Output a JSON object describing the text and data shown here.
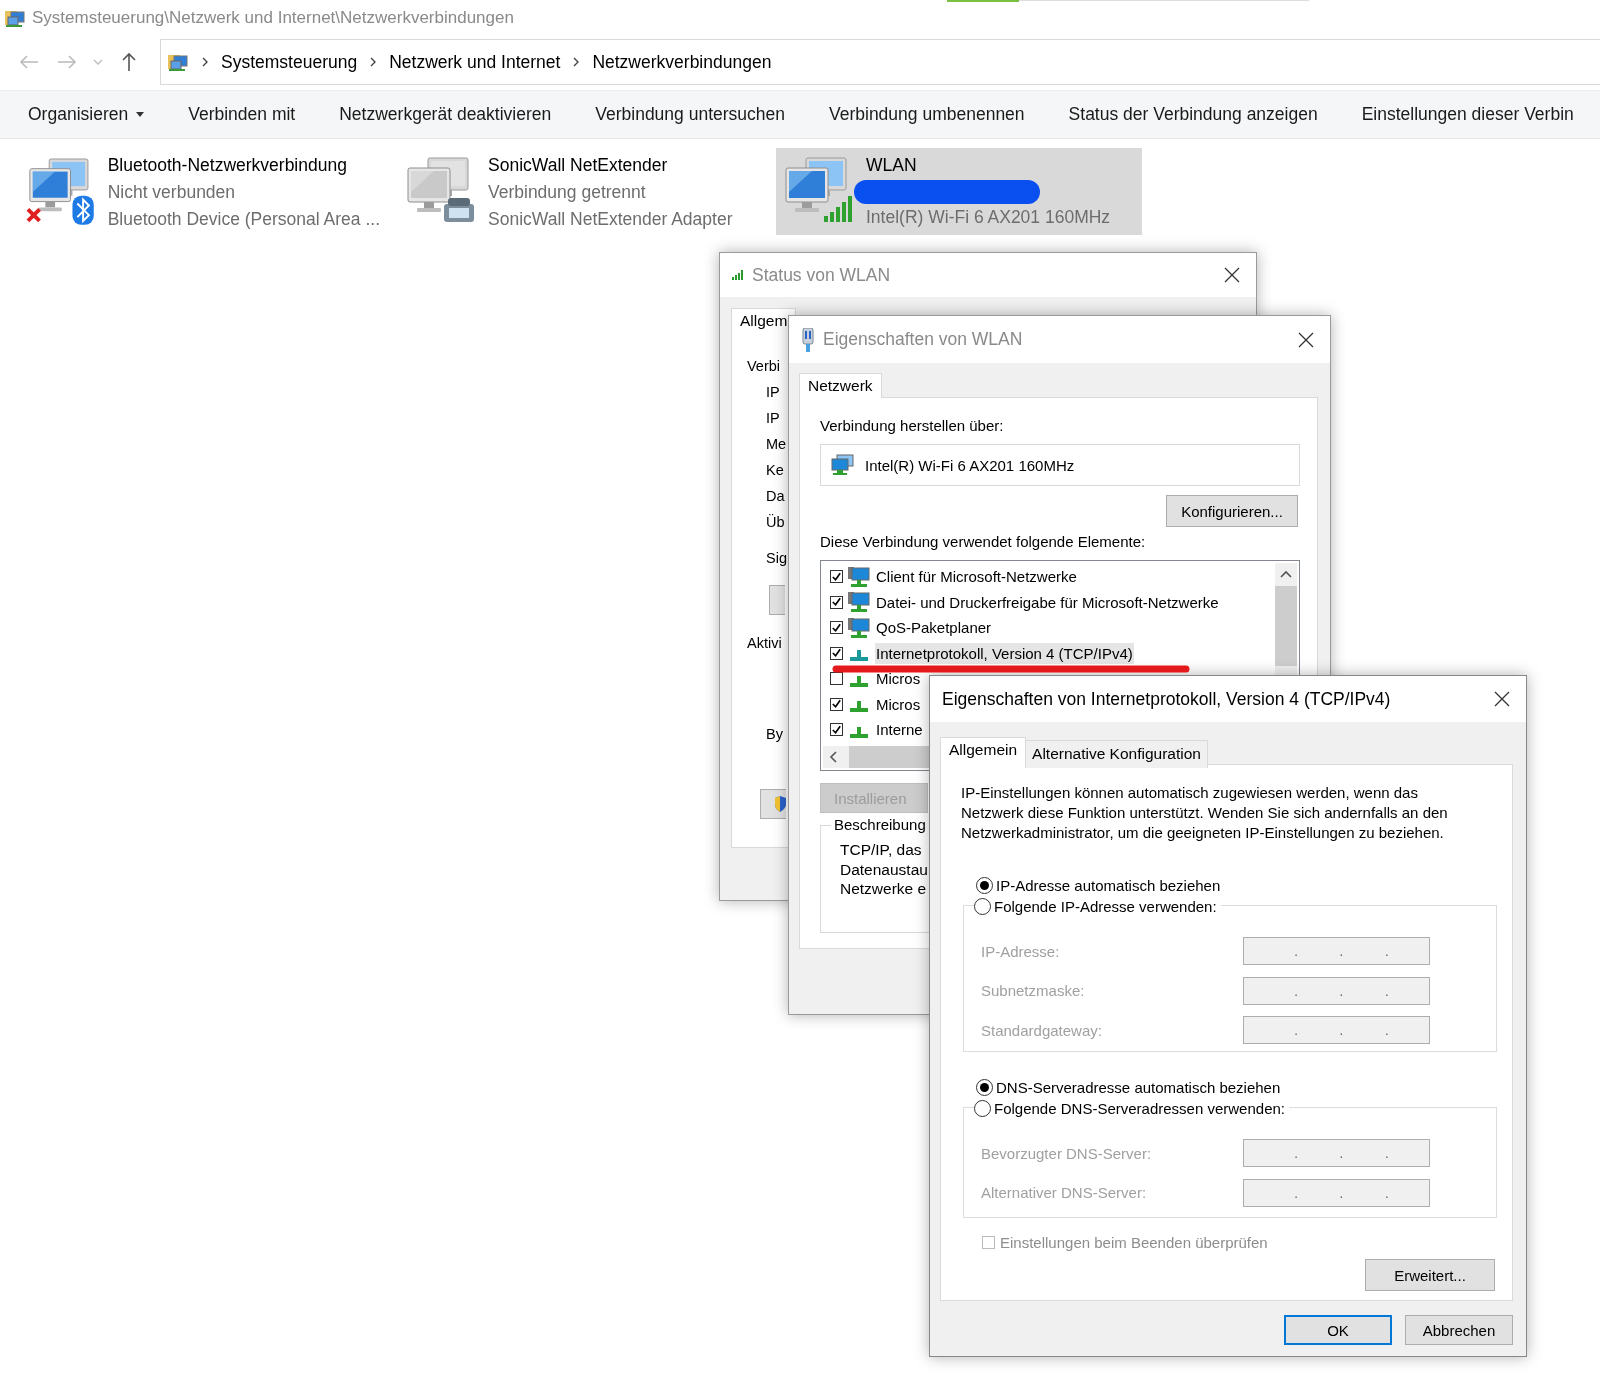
{
  "explorer": {
    "title": "Systemsteuerung\\Netzwerk und Internet\\Netzwerkverbindungen",
    "breadcrumbs": [
      "Systemsteuerung",
      "Netzwerk und Internet",
      "Netzwerkverbindungen"
    ],
    "toolbar": [
      {
        "label": "Organisieren",
        "dropdown": true
      },
      {
        "label": "Verbinden mit",
        "dropdown": false
      },
      {
        "label": "Netzwerkgerät deaktivieren",
        "dropdown": false
      },
      {
        "label": "Verbindung untersuchen",
        "dropdown": false
      },
      {
        "label": "Verbindung umbenennen",
        "dropdown": false
      },
      {
        "label": "Status der Verbindung anzeigen",
        "dropdown": false
      },
      {
        "label": "Einstellungen dieser Verbin",
        "dropdown": false
      }
    ],
    "connections": [
      {
        "kind": "bluetooth",
        "name": "Bluetooth-Netzwerkverbindung",
        "status": "Nicht verbunden",
        "device": "Bluetooth Device (Personal Area ...",
        "selected": false,
        "redacted": false
      },
      {
        "kind": "vpn",
        "name": "SonicWall NetExtender",
        "status": "Verbindung getrennt",
        "device": "SonicWall NetExtender Adapter",
        "selected": false,
        "redacted": false
      },
      {
        "kind": "wifi",
        "name": "WLAN",
        "device": "Intel(R) Wi-Fi 6 AX201 160MHz",
        "selected": true,
        "redacted": true
      }
    ]
  },
  "status_window": {
    "title": "Status von WLAN",
    "active": false,
    "tab": "Allgem",
    "items": [
      {
        "kind": "heading",
        "text": "Verbi"
      },
      {
        "kind": "line",
        "text": "IP"
      },
      {
        "kind": "line",
        "text": "IP"
      },
      {
        "kind": "line",
        "text": "Me"
      },
      {
        "kind": "line",
        "text": "Ke"
      },
      {
        "kind": "line",
        "text": "Da"
      },
      {
        "kind": "line",
        "text": "Üb"
      },
      {
        "kind": "line",
        "text": "Sig"
      },
      {
        "kind": "button"
      },
      {
        "kind": "heading",
        "text": "Aktivi"
      },
      {
        "kind": "line",
        "text": "By"
      },
      {
        "kind": "shield-button"
      }
    ]
  },
  "properties_window": {
    "title": "Eigenschaften von WLAN",
    "active": false,
    "tab": "Netzwerk",
    "connect_label": "Verbindung herstellen über:",
    "adapter": "Intel(R) Wi-Fi 6 AX201 160MHz",
    "configure_button": "Konfigurieren...",
    "items_label": "Diese Verbindung verwendet folgende Elemente:",
    "items": [
      {
        "kind": "service",
        "label": "Client für Microsoft-Netzwerke",
        "checked": true,
        "selected": false
      },
      {
        "kind": "service",
        "label": "Datei- und Druckerfreigabe für Microsoft-Netzwerke",
        "checked": true,
        "selected": false
      },
      {
        "kind": "service",
        "label": "QoS-Paketplaner",
        "checked": true,
        "selected": false
      },
      {
        "kind": "protocol",
        "label": "Internetprotokoll, Version 4 (TCP/IPv4)",
        "checked": true,
        "selected": true
      },
      {
        "kind": "protocol",
        "label": "Micros",
        "checked": false,
        "selected": false
      },
      {
        "kind": "protocol",
        "label": "Micros",
        "checked": true,
        "selected": false
      },
      {
        "kind": "protocol",
        "label": "Interne",
        "checked": true,
        "selected": false
      }
    ],
    "install_button": {
      "label": "Installieren",
      "disabled": true
    },
    "description_title": "Beschreibung",
    "description_lines": [
      "TCP/IP, das",
      "Datenaustau",
      "Netzwerke e"
    ]
  },
  "ipv4_window": {
    "title": "Eigenschaften von Internetprotokoll, Version 4 (TCP/IPv4)",
    "active": true,
    "tabs": [
      {
        "label": "Allgemein",
        "selected": true
      },
      {
        "label": "Alternative Konfiguration",
        "selected": false
      }
    ],
    "description": "IP-Einstellungen können automatisch zugewiesen werden, wenn das Netzwerk diese Funktion unterstützt. Wenden Sie sich andernfalls an den Netzwerkadministrator, um die geeigneten IP-Einstellungen zu beziehen.",
    "ip_options": [
      {
        "label": "IP-Adresse automatisch beziehen",
        "selected": true
      },
      {
        "label": "Folgende IP-Adresse verwenden:",
        "selected": false
      }
    ],
    "ip_fields": [
      {
        "label": "IP-Adresse:",
        "value": ". . .",
        "disabled": true
      },
      {
        "label": "Subnetzmaske:",
        "value": ". . .",
        "disabled": true
      },
      {
        "label": "Standardgateway:",
        "value": ". . .",
        "disabled": true
      }
    ],
    "dns_options": [
      {
        "label": "DNS-Serveradresse automatisch beziehen",
        "selected": true
      },
      {
        "label": "Folgende DNS-Serveradressen verwenden:",
        "selected": false
      }
    ],
    "dns_fields": [
      {
        "label": "Bevorzugter DNS-Server:",
        "value": ". . .",
        "disabled": true
      },
      {
        "label": "Alternativer DNS-Server:",
        "value": ". . .",
        "disabled": true
      }
    ],
    "validate_checkbox": {
      "label": "Einstellungen beim Beenden überprüfen",
      "checked": false,
      "disabled": true
    },
    "advanced_button": "Erweitert...",
    "buttons": [
      {
        "label": "OK",
        "default": true
      },
      {
        "label": "Abbrechen",
        "default": false
      }
    ]
  }
}
